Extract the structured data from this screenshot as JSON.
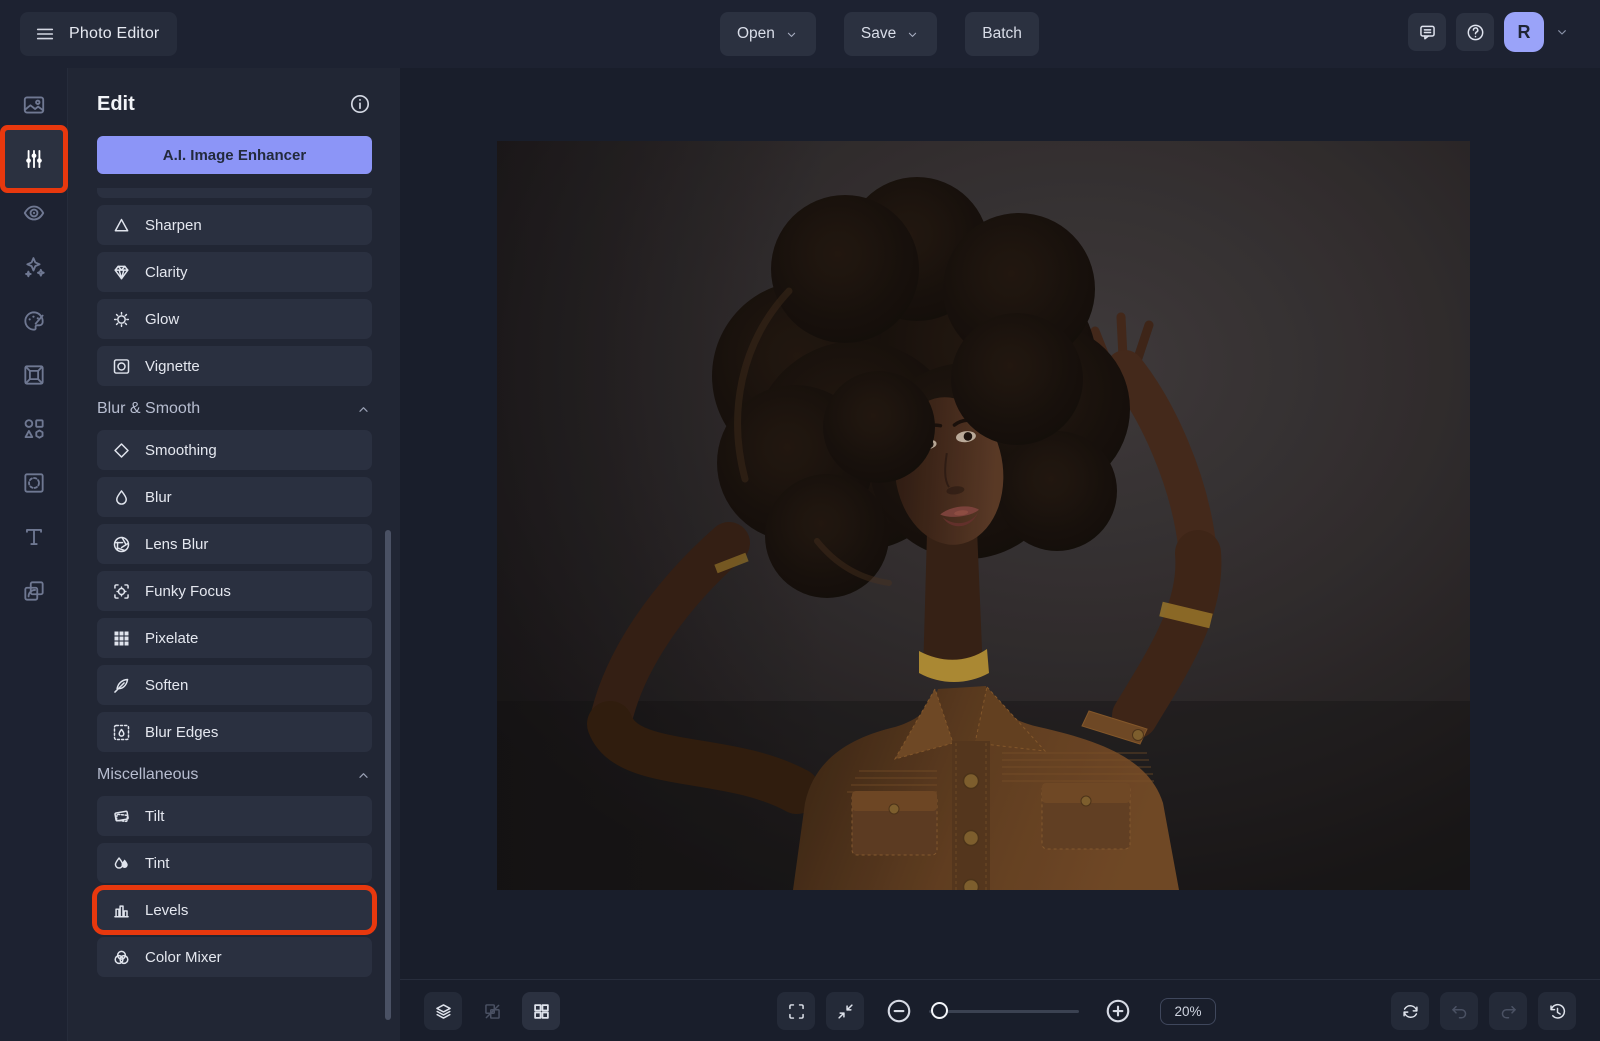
{
  "colors": {
    "accent": "#8c95f7",
    "highlight": "#e8380e",
    "avatar": "#9aa3f9"
  },
  "topbar": {
    "app_title": "Photo Editor",
    "buttons": [
      {
        "name": "open",
        "label": "Open",
        "chevron": true
      },
      {
        "name": "save",
        "label": "Save",
        "chevron": true
      },
      {
        "name": "batch",
        "label": "Batch",
        "chevron": false
      }
    ],
    "right_icons": [
      {
        "name": "feedback",
        "icon": "feedback"
      },
      {
        "name": "help",
        "icon": "help"
      }
    ],
    "avatar_initial": "R"
  },
  "rail": {
    "items": [
      {
        "name": "photo-manager",
        "icon": "image",
        "selected": false
      },
      {
        "name": "edit",
        "icon": "sliders",
        "selected": true
      },
      {
        "name": "touch-up",
        "icon": "eye",
        "selected": false
      },
      {
        "name": "effects",
        "icon": "sparkles",
        "selected": false
      },
      {
        "name": "artsy",
        "icon": "palette",
        "selected": false
      },
      {
        "name": "frames",
        "icon": "frame",
        "selected": false
      },
      {
        "name": "graphics",
        "icon": "shapes",
        "selected": false
      },
      {
        "name": "overlays",
        "icon": "overlay",
        "selected": false
      },
      {
        "name": "text",
        "icon": "text",
        "selected": false
      },
      {
        "name": "textures",
        "icon": "textures",
        "selected": false
      }
    ]
  },
  "panel": {
    "title": "Edit",
    "ai_button_label": "A.I. Image Enhancer",
    "groups": [
      {
        "header": "",
        "items": [
          {
            "label": "Sharpen",
            "icon": "triangle"
          },
          {
            "label": "Clarity",
            "icon": "gem"
          },
          {
            "label": "Glow",
            "icon": "glow"
          },
          {
            "label": "Vignette",
            "icon": "vignette"
          }
        ]
      },
      {
        "header": "Blur & Smooth",
        "items": [
          {
            "label": "Smoothing",
            "icon": "diamond"
          },
          {
            "label": "Blur",
            "icon": "droplet"
          },
          {
            "label": "Lens Blur",
            "icon": "aperture"
          },
          {
            "label": "Funky Focus",
            "icon": "focus"
          },
          {
            "label": "Pixelate",
            "icon": "grid9"
          },
          {
            "label": "Soften",
            "icon": "feather"
          },
          {
            "label": "Blur Edges",
            "icon": "bluredges"
          }
        ]
      },
      {
        "header": "Miscellaneous",
        "items": [
          {
            "label": "Tilt",
            "icon": "tilt"
          },
          {
            "label": "Tint",
            "icon": "tint"
          },
          {
            "label": "Levels",
            "icon": "levels",
            "highlighted": true
          },
          {
            "label": "Color Mixer",
            "icon": "colormixer"
          }
        ]
      }
    ]
  },
  "toolbar": {
    "left": [
      {
        "name": "layers",
        "icon": "layers",
        "style": "normal"
      },
      {
        "name": "compare",
        "icon": "compare",
        "style": "ghost dim"
      },
      {
        "name": "grid-view",
        "icon": "grid4",
        "style": "lit"
      }
    ],
    "zoom_value": "20%",
    "right": [
      {
        "name": "reset",
        "icon": "reset",
        "style": "normal"
      },
      {
        "name": "undo",
        "icon": "undo",
        "style": "dim"
      },
      {
        "name": "redo",
        "icon": "redo",
        "style": "dim"
      },
      {
        "name": "history",
        "icon": "history",
        "style": "normal"
      }
    ]
  }
}
